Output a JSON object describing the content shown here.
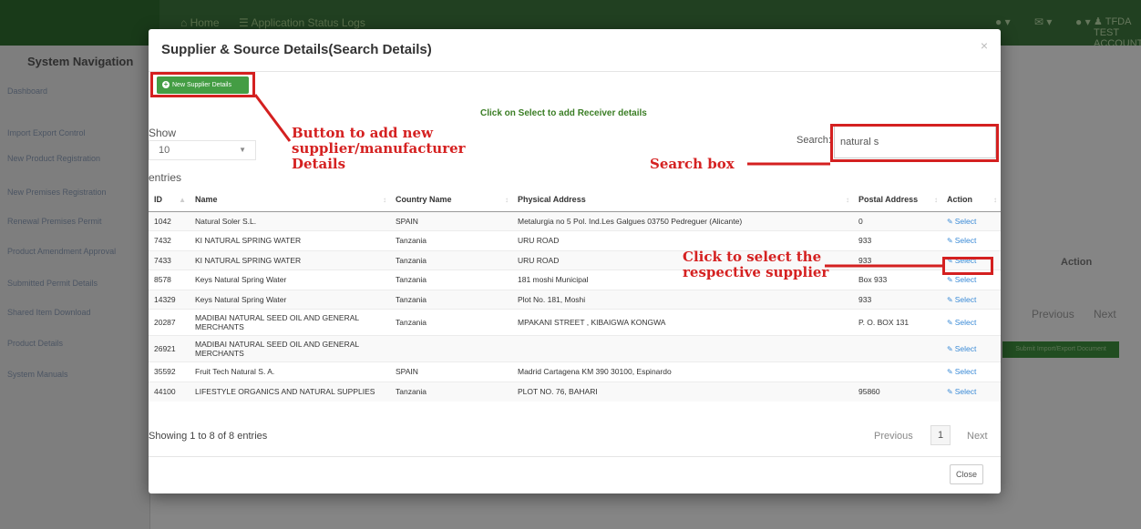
{
  "app": {
    "nav": {
      "home": "Home",
      "status_logs": "Application Status Logs"
    },
    "account": "TFDA TEST ACCOUNT",
    "sidebar": {
      "title": "System Navigation",
      "items": [
        "Dashboard",
        "Import Export Control",
        "New Product Registration",
        "New Premises Registration",
        "Renewal Premises Permit",
        "Product Amendment Approval",
        "Submitted Permit Details",
        "Shared Item Download",
        "Product Details",
        "System Manuals"
      ]
    },
    "bg_action_header": "Action",
    "bg_prev": "Previous",
    "bg_next": "Next",
    "bg_button": "Submit Import/Export Document"
  },
  "modal": {
    "title": "Supplier & Source Details(Search Details)",
    "close_x": "×",
    "new_button": "New Supplier Details",
    "hint": "Click on Select to add Receiver details",
    "show_label": "Show",
    "page_size": "10",
    "entries_label": "entries",
    "search_label": "Search:",
    "search_value": "natural s",
    "columns": [
      "ID",
      "Name",
      "Country Name",
      "Physical Address",
      "Postal Address",
      "Action"
    ],
    "rows": [
      {
        "id": "1042",
        "name": "Natural Soler S.L.",
        "country": "SPAIN",
        "address": "Metalurgia no 5 Pol. Ind.Les Galgues 03750 Pedreguer (Alicante)",
        "postal": "0",
        "action": "Select"
      },
      {
        "id": "7432",
        "name": "KI NATURAL SPRING WATER",
        "country": "Tanzania",
        "address": "URU ROAD",
        "postal": "933",
        "action": "Select"
      },
      {
        "id": "7433",
        "name": "KI NATURAL SPRING WATER",
        "country": "Tanzania",
        "address": "URU ROAD",
        "postal": "933",
        "action": "Select"
      },
      {
        "id": "8578",
        "name": "Keys Natural Spring Water",
        "country": "Tanzania",
        "address": "181 moshi Municipal",
        "postal": "Box 933",
        "action": "Select"
      },
      {
        "id": "14329",
        "name": "Keys Natural Spring Water",
        "country": "Tanzania",
        "address": "Plot No. 181, Moshi",
        "postal": "933",
        "action": "Select"
      },
      {
        "id": "20287",
        "name": "MADIBAI NATURAL SEED OIL AND GENERAL MERCHANTS",
        "country": "Tanzania",
        "address": "MPAKANI STREET , KIBAIGWA KONGWA",
        "postal": "P. O. BOX 131",
        "action": "Select"
      },
      {
        "id": "26921",
        "name": "MADIBAI NATURAL SEED OIL AND GENERAL MERCHANTS",
        "country": "",
        "address": "",
        "postal": "",
        "action": "Select"
      },
      {
        "id": "35592",
        "name": "Fruit Tech Natural S. A.",
        "country": "SPAIN",
        "address": "Madrid Cartagena KM 390 30100, Espinardo",
        "postal": "",
        "action": "Select"
      },
      {
        "id": "44100",
        "name": "LIFESTYLE ORGANICS AND NATURAL SUPPLIES",
        "country": "Tanzania",
        "address": "PLOT NO. 76, BAHARI",
        "postal": "95860",
        "action": "Select"
      }
    ],
    "info": "Showing 1 to 8 of 8 entries",
    "prev": "Previous",
    "page": "1",
    "next": "Next",
    "close": "Close"
  },
  "annotations": {
    "button_note_line1": "Button to add new",
    "button_note_line2": "supplier/manufacturer",
    "button_note_line3": "Details",
    "search_note": "Search box",
    "select_note_line1": "Click to select the",
    "select_note_line2": "respective supplier",
    "color": "#d42020"
  }
}
